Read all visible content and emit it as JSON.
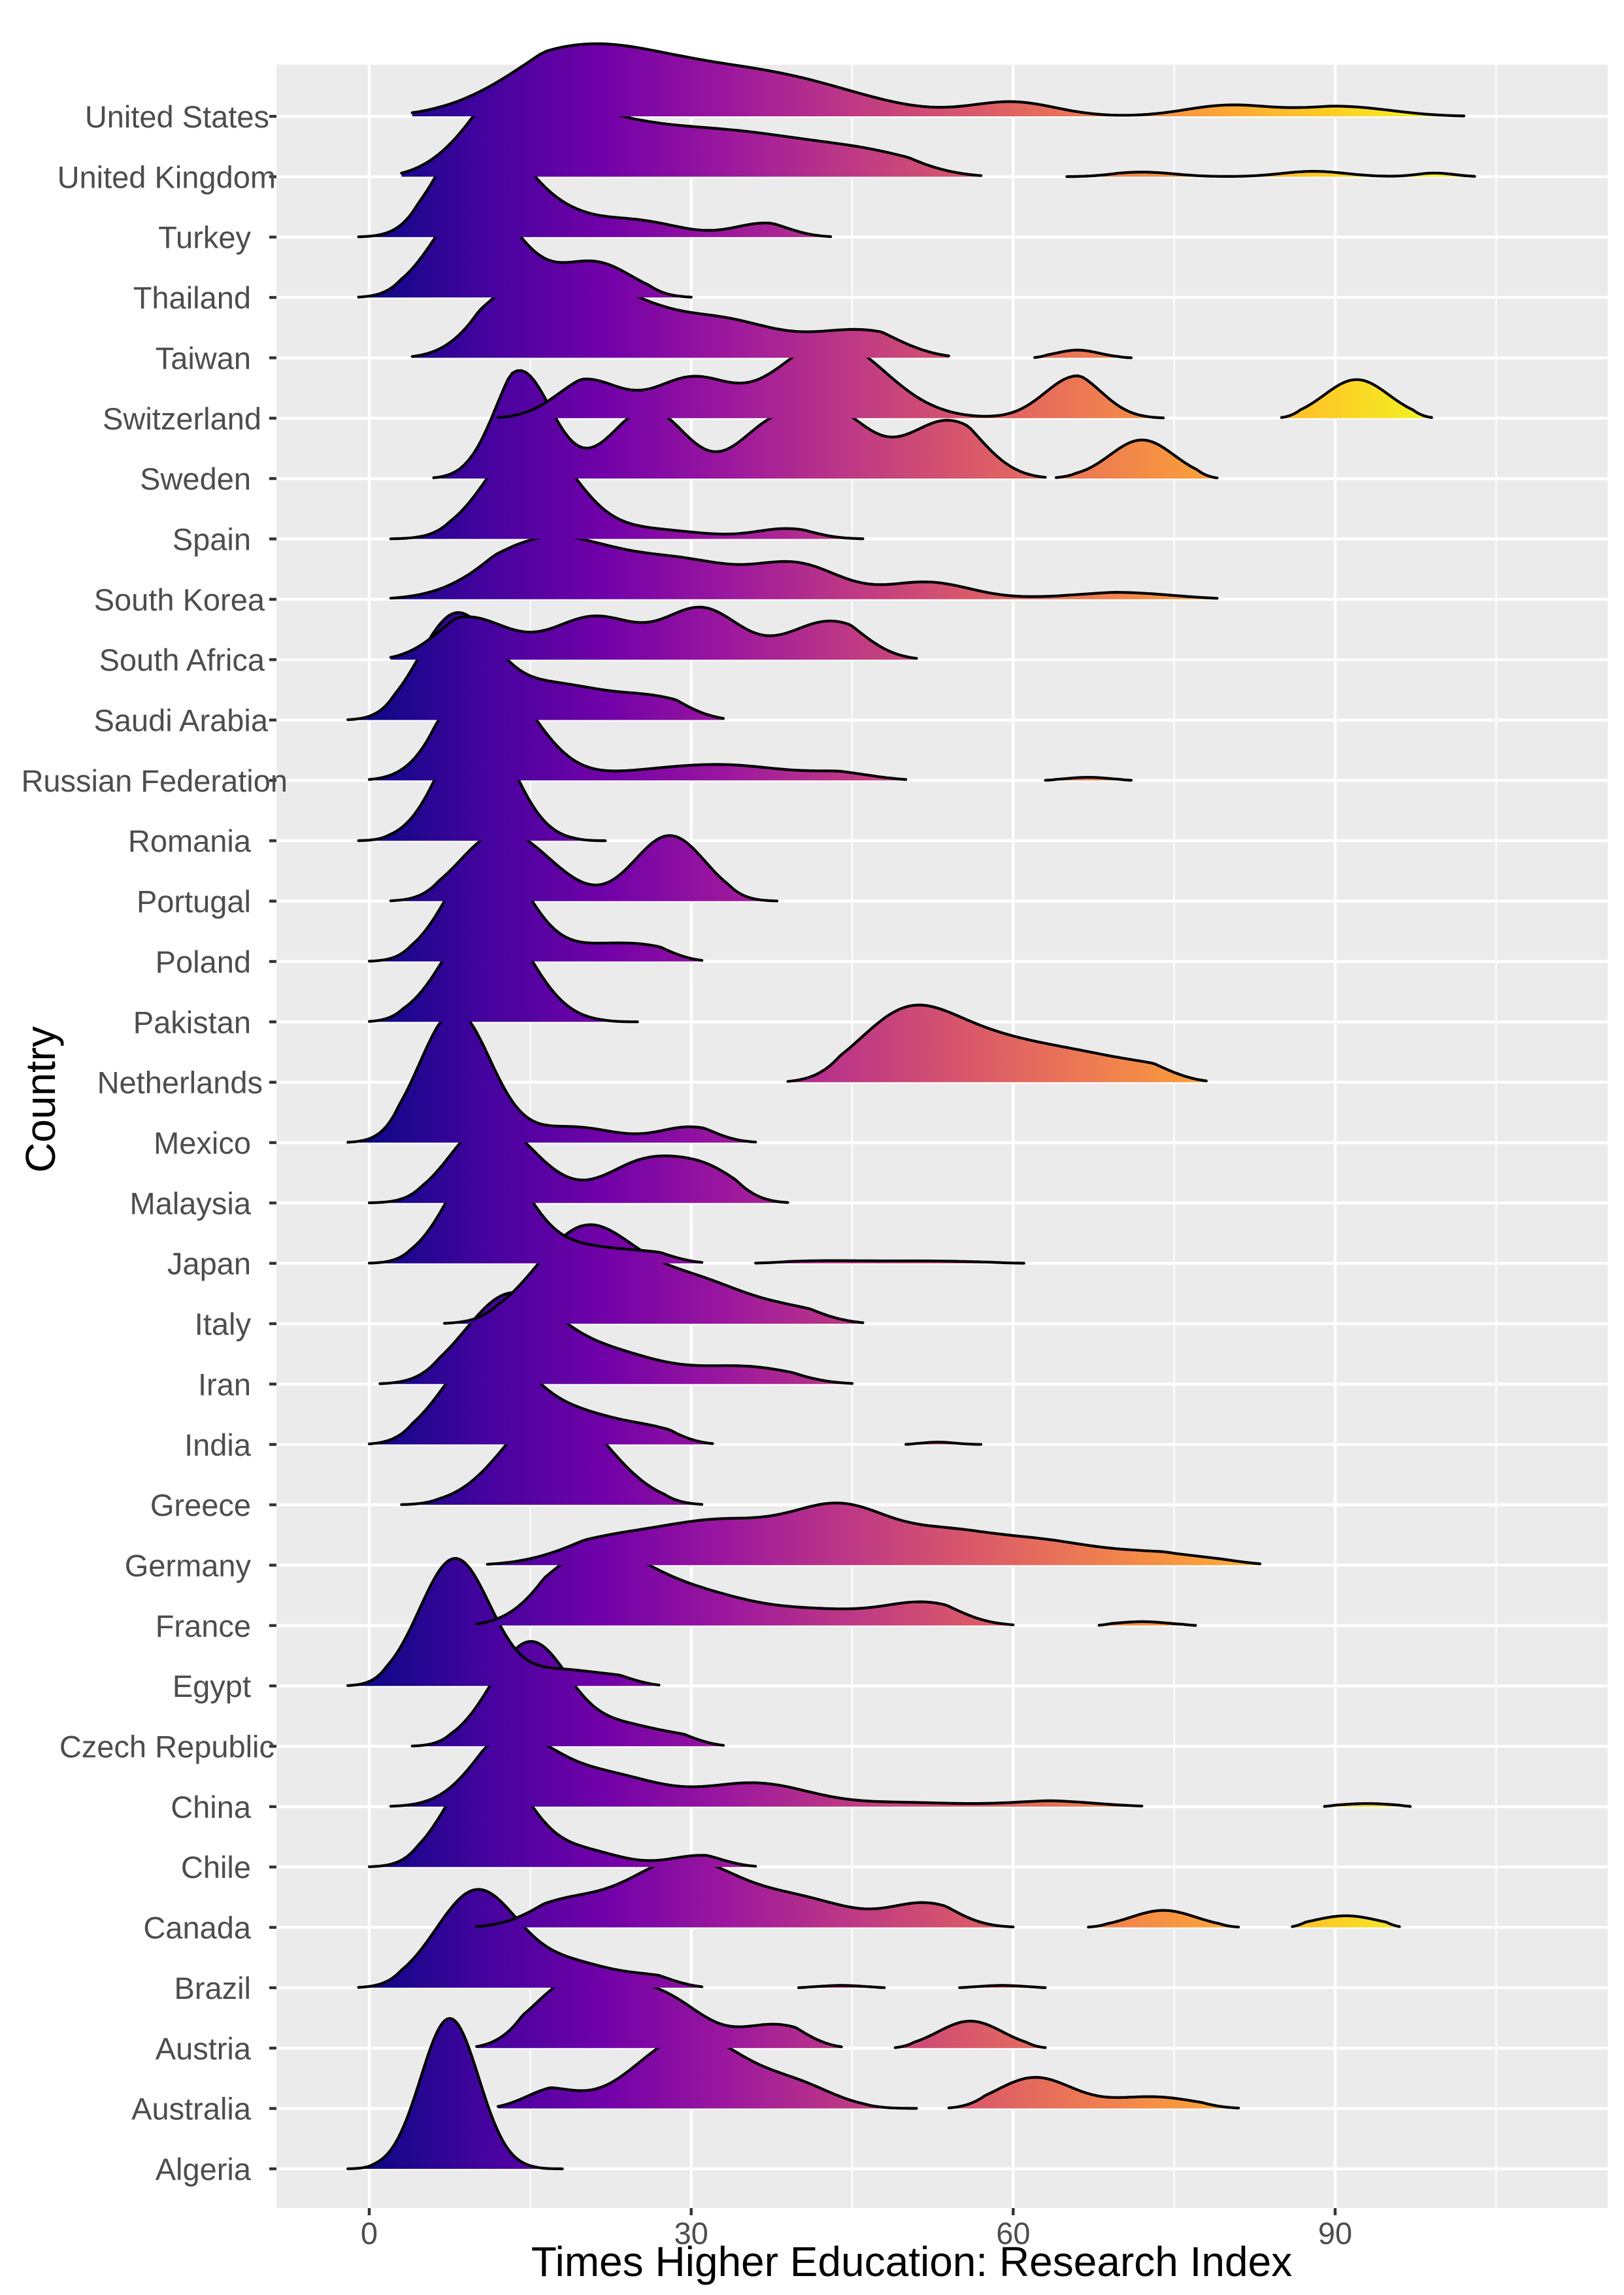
{
  "chart_data": {
    "type": "ridgeline",
    "title": "",
    "xlabel": "Times Higher Education: Research Index",
    "ylabel": "Country",
    "xlim": [
      -6,
      118
    ],
    "x_ticks": [
      0,
      30,
      60,
      90
    ],
    "x_tick_labels": [
      "0",
      "30",
      "60",
      "90"
    ],
    "grid": true,
    "legend": "none",
    "fill_gradient": "plasma (by x value, 0 → 100)",
    "categories": [
      "United States",
      "United Kingdom",
      "Turkey",
      "Thailand",
      "Taiwan",
      "Switzerland",
      "Sweden",
      "Spain",
      "South Korea",
      "South Africa",
      "Saudi Arabia",
      "Russian Federation",
      "Romania",
      "Portugal",
      "Poland",
      "Pakistan",
      "Netherlands",
      "Mexico",
      "Malaysia",
      "Japan",
      "Italy",
      "Iran",
      "India",
      "Greece",
      "Germany",
      "France",
      "Egypt",
      "Czech Republic",
      "China",
      "Chile",
      "Canada",
      "Brazil",
      "Austria",
      "Australia",
      "Algeria"
    ],
    "series": [
      {
        "name": "United States",
        "range": [
          4,
          102
        ],
        "segments": [
          [
            4,
            102
          ]
        ],
        "components": [
          [
            20,
            9,
            0.9
          ],
          [
            38,
            8,
            0.45
          ],
          [
            60,
            4,
            0.18
          ],
          [
            80,
            4,
            0.14
          ],
          [
            92,
            5,
            0.14
          ]
        ]
      },
      {
        "name": "United Kingdom",
        "range": [
          3,
          103
        ],
        "segments": [
          [
            3,
            57
          ],
          [
            65,
            103
          ]
        ],
        "components": [
          [
            14,
            6,
            1.0
          ],
          [
            25,
            6,
            0.45
          ],
          [
            35,
            6,
            0.42
          ],
          [
            46,
            6,
            0.3
          ],
          [
            72,
            3,
            0.06
          ],
          [
            88,
            3,
            0.07
          ],
          [
            100,
            2,
            0.06
          ]
        ]
      },
      {
        "name": "Turkey",
        "range": [
          -1,
          43
        ],
        "segments": [
          [
            -1,
            43
          ]
        ],
        "components": [
          [
            10,
            3.6,
            1.35
          ],
          [
            16,
            4,
            0.35
          ],
          [
            25,
            4,
            0.2
          ],
          [
            37,
            3,
            0.18
          ]
        ]
      },
      {
        "name": "Thailand",
        "range": [
          -1,
          30
        ],
        "segments": [
          [
            -1,
            30
          ]
        ],
        "components": [
          [
            10,
            3.8,
            1.3
          ],
          [
            21,
            3.5,
            0.45
          ]
        ]
      },
      {
        "name": "Taiwan",
        "range": [
          4,
          71
        ],
        "segments": [
          [
            4,
            54
          ],
          [
            62,
            71
          ]
        ],
        "components": [
          [
            14,
            4.5,
            0.8
          ],
          [
            22,
            5,
            0.75
          ],
          [
            33,
            5,
            0.45
          ],
          [
            46,
            5,
            0.35
          ],
          [
            66,
            2,
            0.1
          ]
        ]
      },
      {
        "name": "Switzerland",
        "range": [
          12,
          99
        ],
        "segments": [
          [
            12,
            74
          ],
          [
            85,
            99
          ]
        ],
        "components": [
          [
            20,
            3.5,
            0.5
          ],
          [
            30,
            3.5,
            0.5
          ],
          [
            43,
            5,
            1.0
          ],
          [
            66,
            3,
            0.55
          ],
          [
            92,
            3,
            0.5
          ]
        ]
      },
      {
        "name": "Sweden",
        "range": [
          6,
          79
        ],
        "segments": [
          [
            6,
            63
          ],
          [
            64,
            79
          ]
        ],
        "components": [
          [
            14,
            3,
            1.4
          ],
          [
            26,
            3.5,
            0.9
          ],
          [
            37,
            3,
            0.55
          ],
          [
            43,
            3.5,
            0.85
          ],
          [
            54,
            4,
            0.75
          ],
          [
            72,
            3,
            0.5
          ]
        ]
      },
      {
        "name": "Spain",
        "range": [
          2,
          46
        ],
        "segments": [
          [
            2,
            46
          ]
        ],
        "components": [
          [
            15,
            4,
            1.3
          ],
          [
            26,
            5,
            0.12
          ],
          [
            39,
            3,
            0.13
          ]
        ]
      },
      {
        "name": "South Korea",
        "range": [
          2,
          79
        ],
        "segments": [
          [
            2,
            79
          ]
        ],
        "components": [
          [
            17,
            6.5,
            0.8
          ],
          [
            30,
            5,
            0.4
          ],
          [
            40,
            4,
            0.42
          ],
          [
            52,
            4,
            0.22
          ],
          [
            72,
            6,
            0.1
          ]
        ]
      },
      {
        "name": "South Africa",
        "range": [
          2,
          51
        ],
        "segments": [
          [
            2,
            51
          ]
        ],
        "components": [
          [
            9,
            4,
            0.55
          ],
          [
            21,
            4,
            0.55
          ],
          [
            31,
            3.5,
            0.65
          ],
          [
            43,
            4,
            0.5
          ]
        ]
      },
      {
        "name": "Saudi Arabia",
        "range": [
          -2,
          33
        ],
        "segments": [
          [
            -2,
            33
          ]
        ],
        "components": [
          [
            8,
            3.4,
            1.3
          ],
          [
            17,
            5,
            0.45
          ],
          [
            27,
            4,
            0.25
          ]
        ]
      },
      {
        "name": "Russian Federation",
        "range": [
          0,
          71
        ],
        "segments": [
          [
            0,
            50
          ],
          [
            63,
            71
          ]
        ],
        "components": [
          [
            11,
            4.2,
            1.4
          ],
          [
            26,
            5,
            0.1
          ],
          [
            34,
            5,
            0.17
          ],
          [
            45,
            4,
            0.1
          ],
          [
            67,
            2,
            0.04
          ]
        ]
      },
      {
        "name": "Romania",
        "range": [
          -1,
          22
        ],
        "segments": [
          [
            -1,
            22
          ]
        ],
        "components": [
          [
            10,
            3.3,
            1.6
          ]
        ]
      },
      {
        "name": "Portugal",
        "range": [
          2,
          38
        ],
        "segments": [
          [
            2,
            38
          ]
        ],
        "components": [
          [
            12,
            3.6,
            0.85
          ],
          [
            17,
            3,
            0.2
          ],
          [
            28,
            3.3,
            0.85
          ]
        ]
      },
      {
        "name": "Poland",
        "range": [
          0,
          31
        ],
        "segments": [
          [
            0,
            31
          ]
        ],
        "components": [
          [
            11,
            3.6,
            1.45
          ],
          [
            22,
            4,
            0.2
          ],
          [
            27,
            3,
            0.1
          ]
        ]
      },
      {
        "name": "Pakistan",
        "range": [
          0,
          25
        ],
        "segments": [
          [
            0,
            25
          ]
        ],
        "components": [
          [
            11,
            3.8,
            1.45
          ]
        ]
      },
      {
        "name": "Netherlands",
        "range": [
          39,
          78
        ],
        "segments": [
          [
            39,
            78
          ]
        ],
        "components": [
          [
            50,
            4.5,
            0.85
          ],
          [
            58,
            5,
            0.45
          ],
          [
            67,
            5,
            0.3
          ],
          [
            74,
            3,
            0.1
          ]
        ]
      },
      {
        "name": "Mexico",
        "range": [
          -2,
          36
        ],
        "segments": [
          [
            -2,
            36
          ]
        ],
        "components": [
          [
            8,
            3.3,
            1.7
          ],
          [
            19,
            4,
            0.2
          ],
          [
            30,
            3,
            0.2
          ]
        ]
      },
      {
        "name": "Malaysia",
        "range": [
          0,
          39
        ],
        "segments": [
          [
            0,
            39
          ]
        ],
        "components": [
          [
            11,
            3.5,
            1.0
          ],
          [
            16,
            3,
            0.2
          ],
          [
            26,
            4,
            0.55
          ],
          [
            32,
            3,
            0.3
          ]
        ]
      },
      {
        "name": "Japan",
        "range": [
          0,
          61
        ],
        "segments": [
          [
            0,
            31
          ],
          [
            36,
            61
          ]
        ],
        "components": [
          [
            11,
            3.5,
            1.45
          ],
          [
            20,
            4,
            0.2
          ],
          [
            27,
            3,
            0.1
          ],
          [
            42,
            4,
            0.03
          ],
          [
            52,
            5,
            0.03
          ]
        ]
      },
      {
        "name": "Italy",
        "range": [
          7,
          46
        ],
        "segments": [
          [
            7,
            46
          ]
        ],
        "components": [
          [
            20,
            4.5,
            1.2
          ],
          [
            30,
            5,
            0.55
          ],
          [
            40,
            4,
            0.15
          ]
        ]
      },
      {
        "name": "Iran",
        "range": [
          1,
          45
        ],
        "segments": [
          [
            1,
            45
          ]
        ],
        "components": [
          [
            13,
            4.2,
            1.1
          ],
          [
            22,
            5,
            0.4
          ],
          [
            35,
            5,
            0.22
          ]
        ]
      },
      {
        "name": "India",
        "range": [
          0,
          57
        ],
        "segments": [
          [
            0,
            32
          ],
          [
            50,
            57
          ]
        ],
        "components": [
          [
            11,
            4,
            1.25
          ],
          [
            20,
            4,
            0.35
          ],
          [
            27,
            3,
            0.15
          ],
          [
            53,
            1.5,
            0.03
          ]
        ]
      },
      {
        "name": "Greece",
        "range": [
          3,
          31
        ],
        "segments": [
          [
            3,
            31
          ]
        ],
        "components": [
          [
            17,
            4.5,
            1.2
          ],
          [
            22,
            4,
            0.15
          ]
        ]
      },
      {
        "name": "Germany",
        "range": [
          11,
          83
        ],
        "segments": [
          [
            11,
            83
          ]
        ],
        "components": [
          [
            23,
            6,
            0.35
          ],
          [
            33,
            5,
            0.45
          ],
          [
            44,
            5,
            0.75
          ],
          [
            54,
            4,
            0.3
          ],
          [
            62,
            5,
            0.3
          ],
          [
            73,
            5,
            0.15
          ],
          [
            80,
            3,
            0.08
          ]
        ]
      },
      {
        "name": "France",
        "range": [
          10,
          77
        ],
        "segments": [
          [
            10,
            60
          ],
          [
            68,
            77
          ]
        ],
        "components": [
          [
            21,
            5,
            0.95
          ],
          [
            31,
            5,
            0.35
          ],
          [
            42,
            5,
            0.18
          ],
          [
            52,
            4,
            0.28
          ],
          [
            72,
            2.5,
            0.05
          ]
        ]
      },
      {
        "name": "Egypt",
        "range": [
          -2,
          27
        ],
        "segments": [
          [
            -2,
            27
          ]
        ],
        "components": [
          [
            8,
            3.3,
            1.65
          ],
          [
            18,
            3.5,
            0.2
          ],
          [
            24,
            2.5,
            0.08
          ]
        ]
      },
      {
        "name": "Czech Republic",
        "range": [
          4,
          33
        ],
        "segments": [
          [
            4,
            33
          ]
        ],
        "components": [
          [
            15,
            3.6,
            1.35
          ],
          [
            24,
            3.5,
            0.25
          ],
          [
            30,
            2.5,
            0.08
          ]
        ]
      },
      {
        "name": "China",
        "range": [
          2,
          97
        ],
        "segments": [
          [
            2,
            72
          ],
          [
            89,
            97
          ]
        ],
        "components": [
          [
            13,
            4,
            0.85
          ],
          [
            22,
            5,
            0.4
          ],
          [
            36,
            5,
            0.3
          ],
          [
            50,
            5,
            0.05
          ],
          [
            65,
            5,
            0.08
          ],
          [
            93,
            2.5,
            0.04
          ]
        ]
      },
      {
        "name": "Chile",
        "range": [
          0,
          36
        ],
        "segments": [
          [
            0,
            36
          ]
        ],
        "components": [
          [
            11,
            3.6,
            1.4
          ],
          [
            20,
            3.5,
            0.2
          ],
          [
            31,
            3,
            0.15
          ]
        ]
      },
      {
        "name": "Canada",
        "range": [
          10,
          96
        ],
        "segments": [
          [
            10,
            60
          ],
          [
            67,
            81
          ],
          [
            86,
            96
          ]
        ],
        "components": [
          [
            18,
            4,
            0.3
          ],
          [
            29,
            5,
            0.85
          ],
          [
            40,
            5,
            0.35
          ],
          [
            52,
            3.5,
            0.3
          ],
          [
            74,
            3,
            0.22
          ],
          [
            91,
            3,
            0.15
          ]
        ]
      },
      {
        "name": "Brazil",
        "range": [
          -1,
          63
        ],
        "segments": [
          [
            -1,
            31
          ],
          [
            40,
            48
          ],
          [
            55,
            63
          ]
        ],
        "components": [
          [
            10,
            3.8,
            1.25
          ],
          [
            19,
            4,
            0.3
          ],
          [
            27,
            3,
            0.12
          ],
          [
            44,
            2,
            0.03
          ],
          [
            59,
            2,
            0.03
          ]
        ]
      },
      {
        "name": "Austria",
        "range": [
          10,
          63
        ],
        "segments": [
          [
            10,
            44
          ],
          [
            49,
            63
          ]
        ],
        "components": [
          [
            20,
            4.5,
            0.95
          ],
          [
            28,
            3.5,
            0.5
          ],
          [
            38,
            3.5,
            0.3
          ],
          [
            56,
            3,
            0.35
          ]
        ]
      },
      {
        "name": "Australia",
        "range": [
          12,
          81
        ],
        "segments": [
          [
            12,
            51
          ],
          [
            54,
            81
          ]
        ],
        "components": [
          [
            16,
            3,
            0.25
          ],
          [
            30,
            5,
            0.95
          ],
          [
            40,
            3.5,
            0.25
          ],
          [
            62,
            3.5,
            0.4
          ],
          [
            73,
            4,
            0.15
          ]
        ]
      },
      {
        "name": "Algeria",
        "range": [
          -2,
          18
        ],
        "segments": [
          [
            -2,
            18
          ]
        ],
        "components": [
          [
            7.5,
            2.7,
            1.95
          ]
        ]
      }
    ]
  }
}
